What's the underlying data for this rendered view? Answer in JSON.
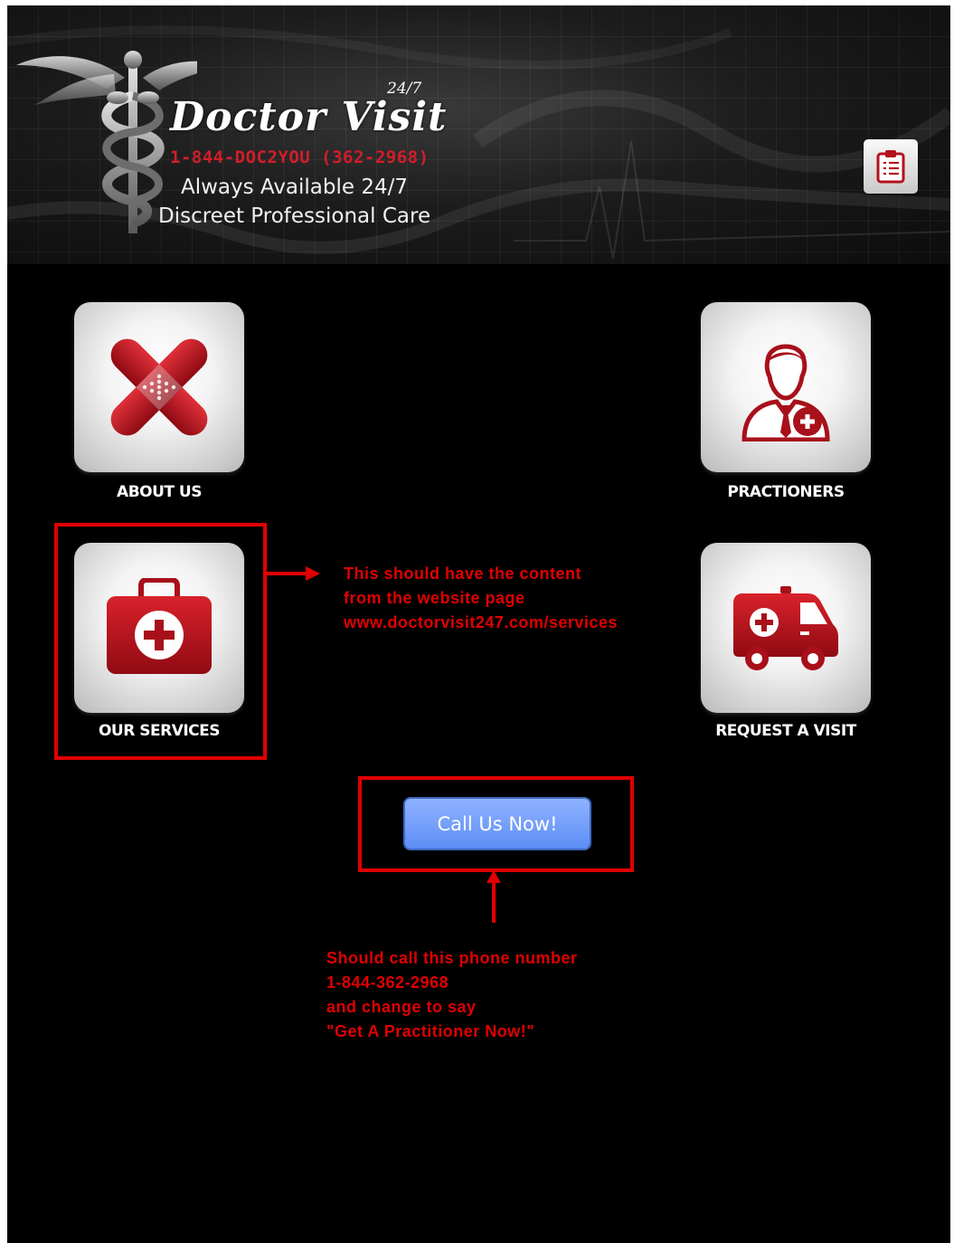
{
  "header": {
    "brand_247": "24/7",
    "brand_name": "Doctor Visit",
    "phone": "1-844-DOC2YOU (362-2968)",
    "tagline_1": "Always Available 24/7",
    "tagline_2": "Discreet Professional Care",
    "clipboard_icon": "clipboard-icon"
  },
  "tiles": [
    {
      "label": "ABOUT US",
      "icon": "bandage-x-icon"
    },
    {
      "label": "PRACTIONERS",
      "icon": "doctor-icon"
    },
    {
      "label": "OUR SERVICES",
      "icon": "medical-kit-icon"
    },
    {
      "label": "REQUEST A VISIT",
      "icon": "ambulance-icon"
    }
  ],
  "call_button": {
    "label": "Call Us Now!"
  },
  "annotations": {
    "services_note": "This should have the content\nfrom the website page\nwww.doctorvisit247.com/services",
    "call_note": "Should call this phone number\n1-844-362-2968\nand change to say\n\"Get A Practitioner Now!\""
  },
  "colors": {
    "background": "#000000",
    "brand_red": "#c4101c",
    "annotation_red": "#e00000",
    "button_blue": "#6f9bf7"
  }
}
